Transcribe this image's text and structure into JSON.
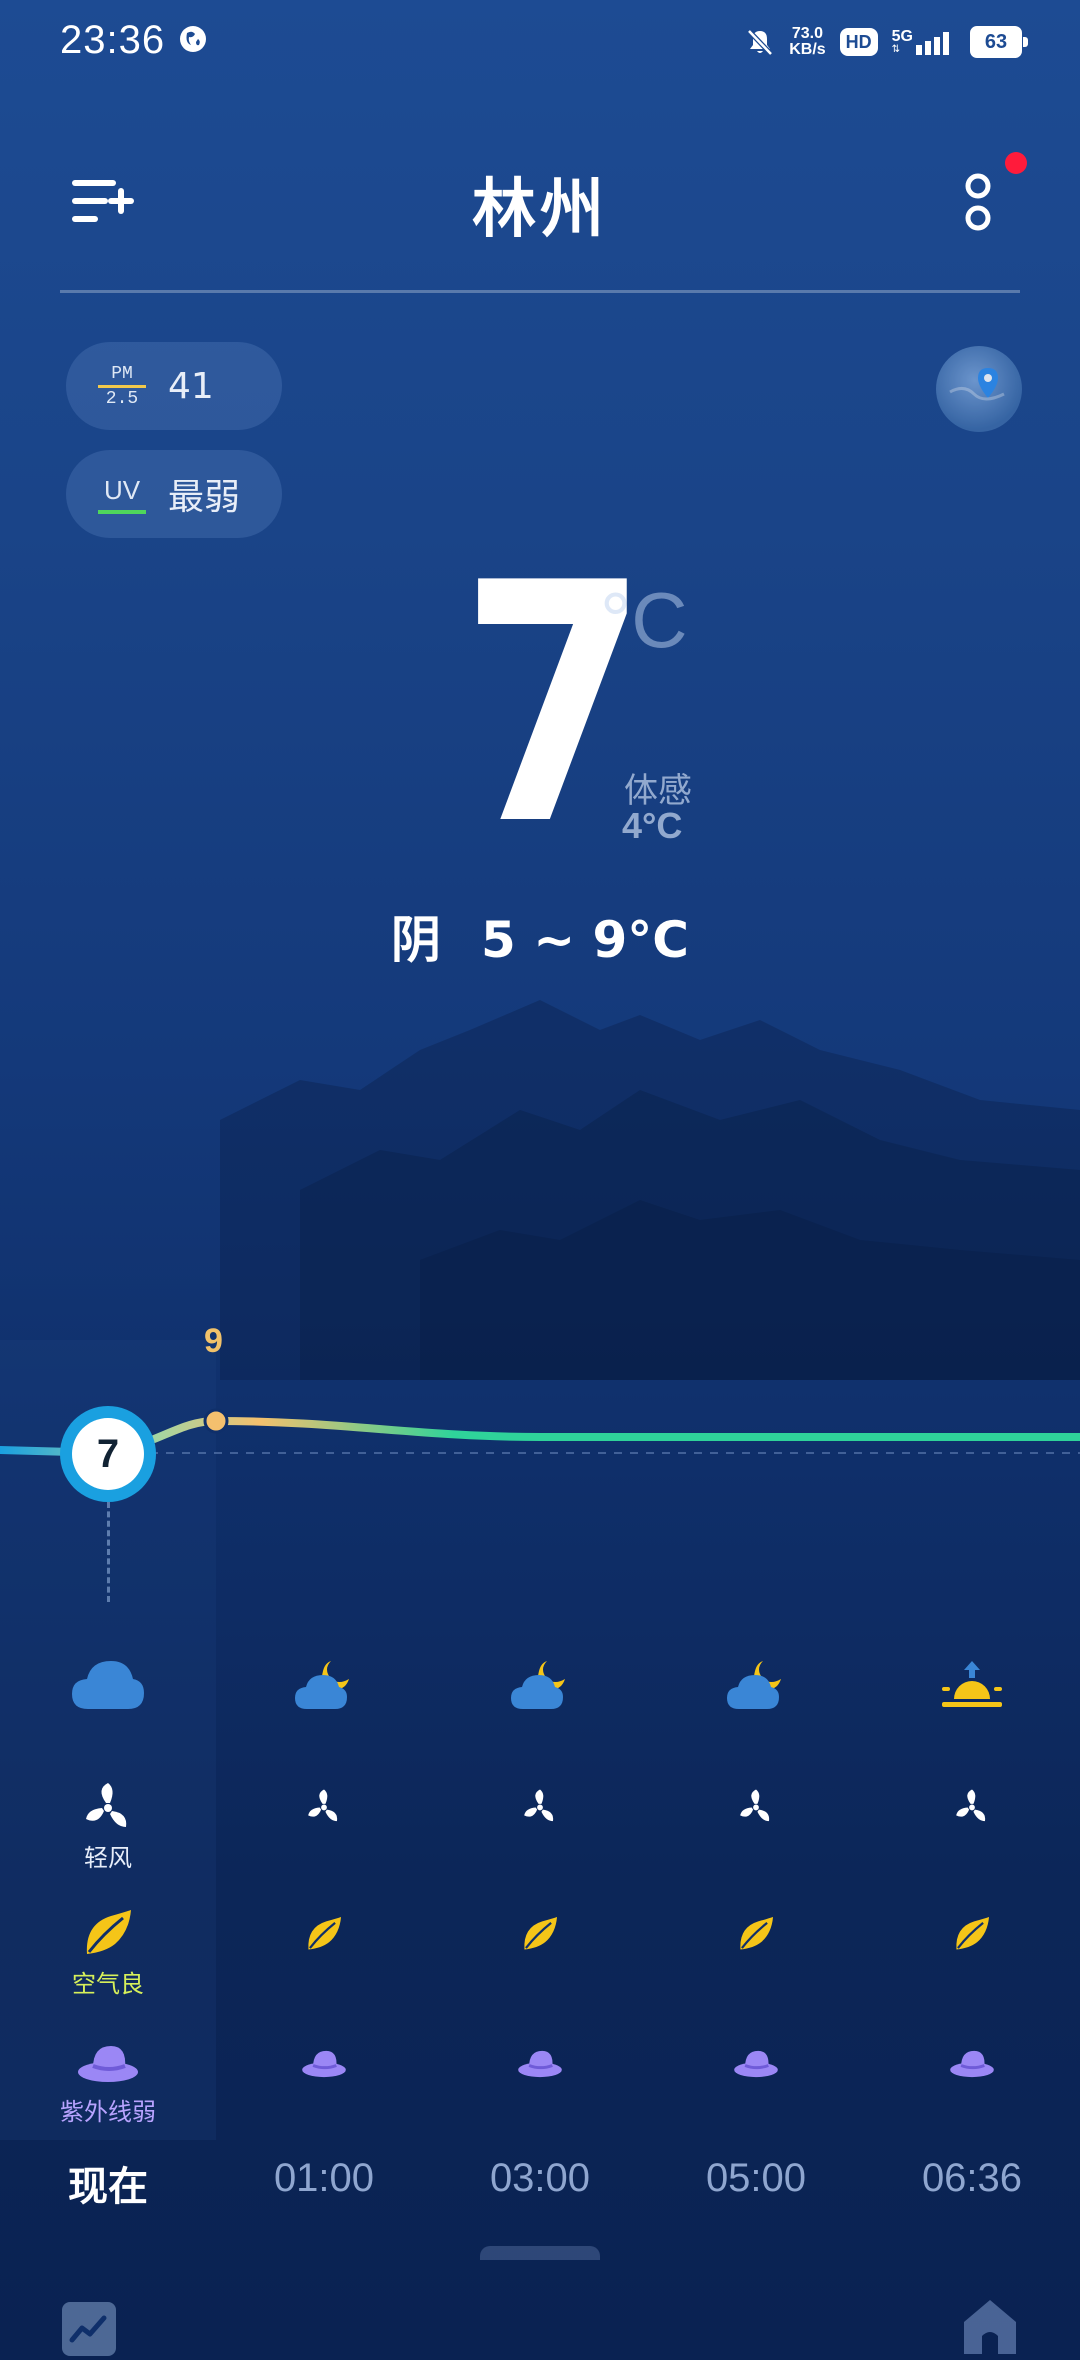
{
  "status_bar": {
    "time": "23:36",
    "net_speed_value": "73.0",
    "net_speed_unit": "KB/s",
    "hd": "HD",
    "network": "5G",
    "battery": "63"
  },
  "header": {
    "city": "林州"
  },
  "chips": {
    "pm_label_top": "PM",
    "pm_label_bottom": "2.5",
    "pm_value": "41",
    "uv_label": "UV",
    "uv_value": "最弱"
  },
  "current": {
    "temp": "7",
    "unit": "°C",
    "feels_label": "体感",
    "feels_value": "4°C",
    "condition": "阴",
    "range": "5 ~ 9°C"
  },
  "chart_data": {
    "type": "line",
    "categories": [
      "现在",
      "01:00",
      "03:00",
      "05:00",
      "06:36"
    ],
    "series": [
      {
        "values": [
          7,
          9,
          8,
          8,
          8
        ]
      }
    ],
    "annotations": [
      "7",
      "9"
    ]
  },
  "hourly": [
    {
      "time": "现在",
      "weather_icon": "cloud-icon",
      "wind": "轻风",
      "air": "空气良",
      "uv": "紫外线弱"
    },
    {
      "time": "01:00",
      "weather_icon": "cloudy-night-icon"
    },
    {
      "time": "03:00",
      "weather_icon": "cloudy-night-icon"
    },
    {
      "time": "05:00",
      "weather_icon": "cloudy-night-icon"
    },
    {
      "time": "06:36",
      "weather_icon": "sunrise-icon"
    }
  ],
  "colors": {
    "accent_orange": "#f2c26a",
    "accent_green": "#2fd39a",
    "now_marker": "#1aa0e0",
    "air_good": "#d7f05a",
    "uv_purple": "#b8a3ff",
    "notification_dot": "#ff1b3b"
  }
}
